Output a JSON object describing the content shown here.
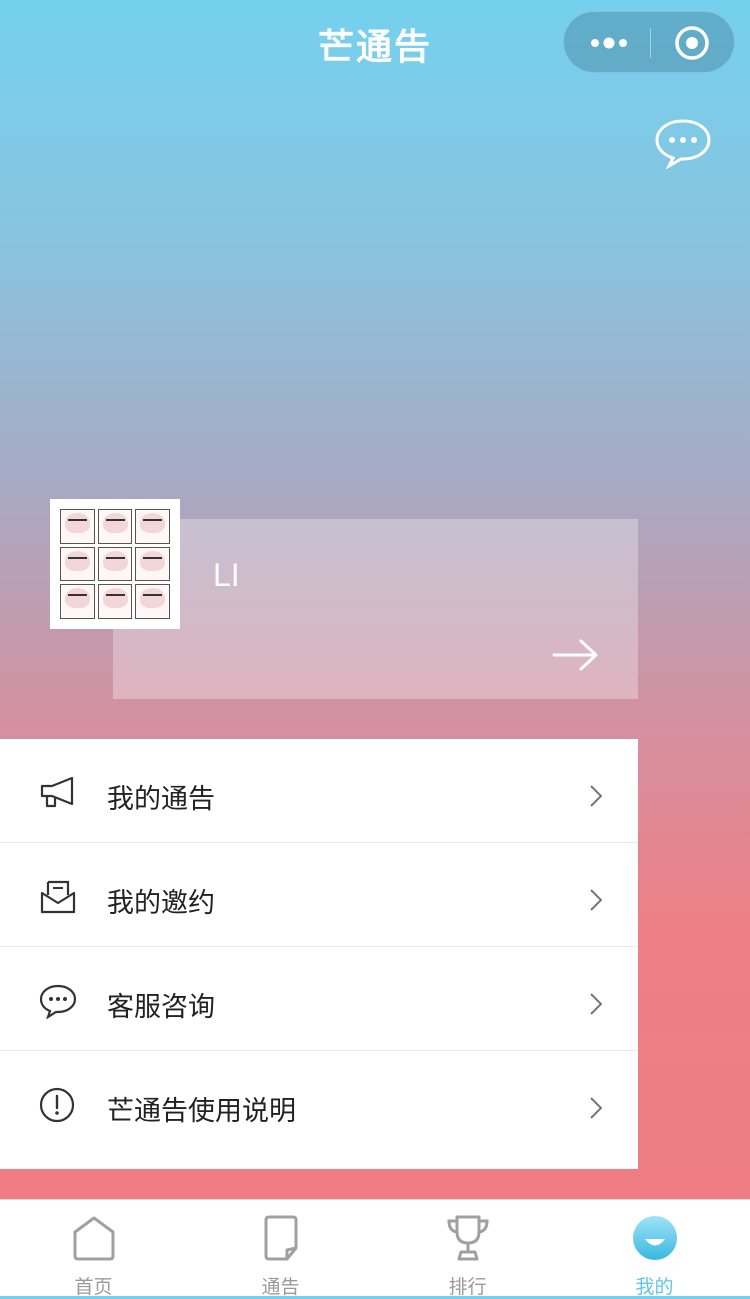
{
  "header": {
    "title": "芒通告"
  },
  "capsule": {
    "more_icon": "more-dots-icon",
    "close_icon": "target-circle-icon"
  },
  "profile": {
    "name": "LI",
    "arrow_icon": "arrow-right-icon"
  },
  "menu": {
    "items": [
      {
        "label": "我的通告",
        "icon": "megaphone-icon"
      },
      {
        "label": "我的邀约",
        "icon": "envelope-icon"
      },
      {
        "label": "客服咨询",
        "icon": "chat-bubble-icon"
      },
      {
        "label": "芒通告使用说明",
        "icon": "info-exclamation-icon"
      }
    ]
  },
  "tabbar": {
    "tabs": [
      {
        "label": "首页",
        "icon": "home-icon",
        "active": false
      },
      {
        "label": "通告",
        "icon": "document-icon",
        "active": false
      },
      {
        "label": "排行",
        "icon": "trophy-icon",
        "active": false
      },
      {
        "label": "我的",
        "icon": "profile-face-icon",
        "active": true
      }
    ]
  },
  "colors": {
    "active_tab": "#5fc7e6",
    "inactive_tab": "#9a9a9a",
    "gradient_top": "#74d1ee",
    "gradient_bottom": "#f07c82"
  }
}
